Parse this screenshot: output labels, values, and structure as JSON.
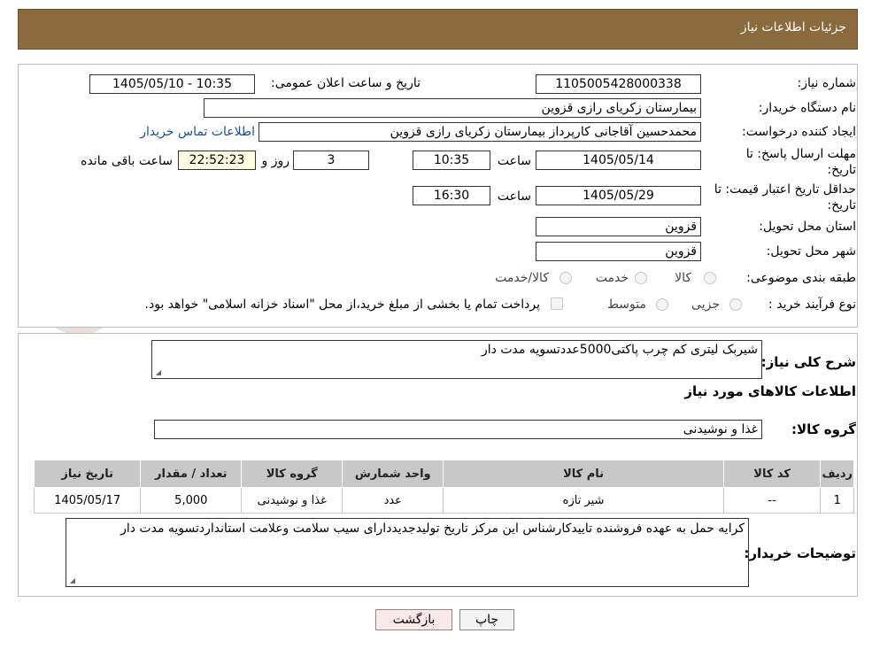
{
  "header": {
    "title": "جزئیات اطلاعات نیاز"
  },
  "form": {
    "need_number_label": "شماره نیاز:",
    "need_number": "1105005428000338",
    "announce_label": "تاریخ و ساعت اعلان عمومی:",
    "announce_value": "1405/05/10 - 10:35",
    "buyer_org_label": "نام دستگاه خریدار:",
    "buyer_org": "بیمارستان زکریای رازی قزوین",
    "creator_label": "ایجاد کننده درخواست:",
    "creator": "محمدحسین آقاجانی کارپرداز بیمارستان زکریای رازی قزوین",
    "contact_link": "اطلاعات تماس خریدار",
    "deadline_label_1": "مهلت ارسال پاسخ: تا",
    "deadline_label_2": "تاریخ:",
    "deadline_date": "1405/05/14",
    "time_label": "ساعت",
    "deadline_time": "10:35",
    "days_value": "3",
    "days_label": "روز و",
    "remaining_time": "22:52:23",
    "remaining_label": "ساعت باقی مانده",
    "validity_label_1": "حداقل تاریخ اعتبار قیمت: تا",
    "validity_label_2": "تاریخ:",
    "validity_date": "1405/05/29",
    "validity_time_label": "ساعت",
    "validity_time": "16:30",
    "province_label": "استان محل تحویل:",
    "province": "قزوین",
    "city_label": "شهر محل تحویل:",
    "city": "قزوین",
    "category_label": "طبقه بندی موضوعی:",
    "category_opt1": "کالا",
    "category_opt2": "خدمت",
    "category_opt3": "کالا/خدمت",
    "process_label": "نوع فرآیند خرید :",
    "process_opt1": "جزیی",
    "process_opt2": "متوسط",
    "payment_note": "پرداخت تمام یا بخشی از مبلغ خرید،از محل \"اسناد خزانه اسلامی\" خواهد بود."
  },
  "details": {
    "summary_label": "شرح کلی نیاز:",
    "summary": "شیربک لیتری کم چرب پاکتی5000عددتسویه مدت دار",
    "goods_info_title": "اطلاعات کالاهای مورد نیاز",
    "group_label": "گروه کالا:",
    "group_value": "غذا و نوشیدنی",
    "table_headers": [
      "ردیف",
      "کد کالا",
      "نام کالا",
      "واحد شمارش",
      "گروه کالا",
      "تعداد / مقدار",
      "تاریخ نیاز"
    ],
    "table_rows": [
      [
        "1",
        "--",
        "شیر تازه",
        "عدد",
        "غذا و نوشیدنی",
        "5,000",
        "1405/05/17"
      ]
    ],
    "buyer_notes_label": "توضیحات خریدار:",
    "buyer_notes": "کرایه حمل به عهده فروشنده تاییدکارشناس این مرکز تاریخ تولیدجدیددارای سیب سلامت وعلامت استانداردتسویه مدت دار"
  },
  "buttons": {
    "print": "چاپ",
    "back": "بازگشت"
  },
  "watermark": {
    "text": "AriaTender.neT"
  },
  "colors": {
    "header_bg": "#8b6b3e",
    "link": "#1a4fa0",
    "back_button_bg": "#fde8e8",
    "table_header_bg": "#c8c8c8"
  }
}
